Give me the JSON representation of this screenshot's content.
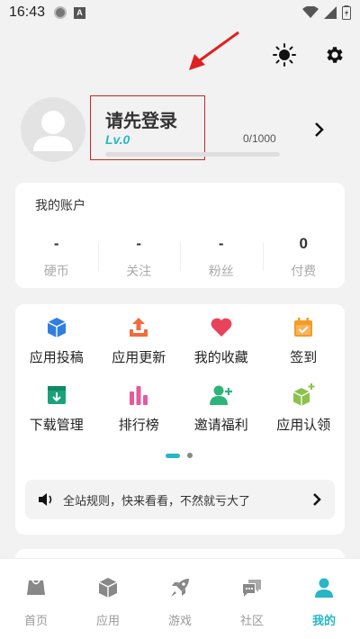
{
  "status_bar": {
    "time": "16:43",
    "a_label": "A"
  },
  "profile": {
    "login_title": "请先登录",
    "level": "Lv.0",
    "exp": "0/1000"
  },
  "account": {
    "title": "我的账户",
    "stats": [
      {
        "value": "-",
        "label": "硬币"
      },
      {
        "value": "-",
        "label": "关注"
      },
      {
        "value": "-",
        "label": "粉丝"
      },
      {
        "value": "0",
        "label": "付费"
      }
    ]
  },
  "tools": [
    {
      "label": "应用投稿",
      "icon": "cube-icon",
      "color": "#2f7fe0"
    },
    {
      "label": "应用更新",
      "icon": "upload-icon",
      "color": "#f26b3a"
    },
    {
      "label": "我的收藏",
      "icon": "heart-icon",
      "color": "#e8435b"
    },
    {
      "label": "签到",
      "icon": "calendar-check-icon",
      "color": "#f59a23"
    },
    {
      "label": "下载管理",
      "icon": "download-box-icon",
      "color": "#1aa37a"
    },
    {
      "label": "排行榜",
      "icon": "bar-chart-icon",
      "color": "#e55a9c"
    },
    {
      "label": "邀请福利",
      "icon": "add-user-icon",
      "color": "#2bb57a"
    },
    {
      "label": "应用认领",
      "icon": "cube-plus-icon",
      "color": "#8bc34a"
    }
  ],
  "notice": {
    "text": "全站规则，快来看看，不然就亏大了"
  },
  "tabbar": [
    {
      "label": "首页",
      "icon": "home-icon",
      "active": false
    },
    {
      "label": "应用",
      "icon": "app-cube-icon",
      "active": false
    },
    {
      "label": "游戏",
      "icon": "rocket-icon",
      "active": false
    },
    {
      "label": "社区",
      "icon": "chat-icon",
      "active": false
    },
    {
      "label": "我的",
      "icon": "user-icon",
      "active": true
    }
  ],
  "colors": {
    "accent": "#27b6c7",
    "highlight_box": "#c62828",
    "background": "#f2f2f2"
  }
}
